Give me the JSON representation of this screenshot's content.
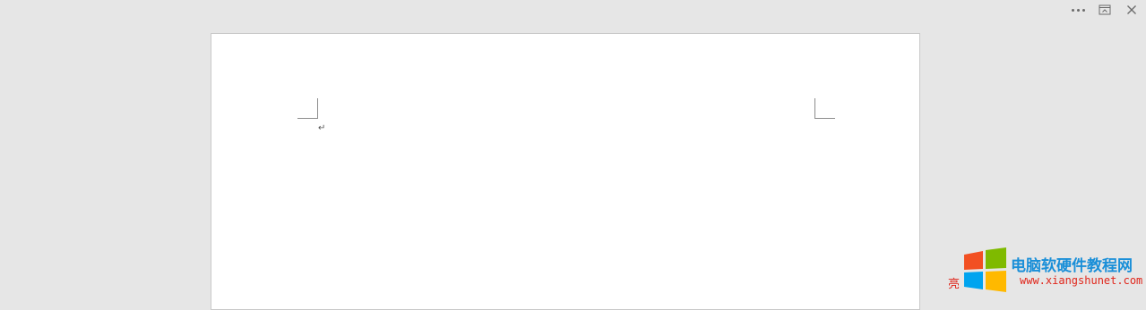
{
  "window_controls": {
    "more_icon": "more-horizontal-icon",
    "restore_icon": "restore-window-icon",
    "close_icon": "close-icon",
    "close_glyph": "✕"
  },
  "document": {
    "paragraph_mark": "↵"
  },
  "watermark": {
    "title": "电脑软硬件教程网",
    "subtitle": "亮",
    "url": "www.xiangshunet.com",
    "colors": {
      "title": "#1a8fd8",
      "url": "#e0261b",
      "logo_red": "#f25022",
      "logo_green": "#7fba00",
      "logo_blue": "#00a4ef",
      "logo_yellow": "#ffb900"
    }
  }
}
